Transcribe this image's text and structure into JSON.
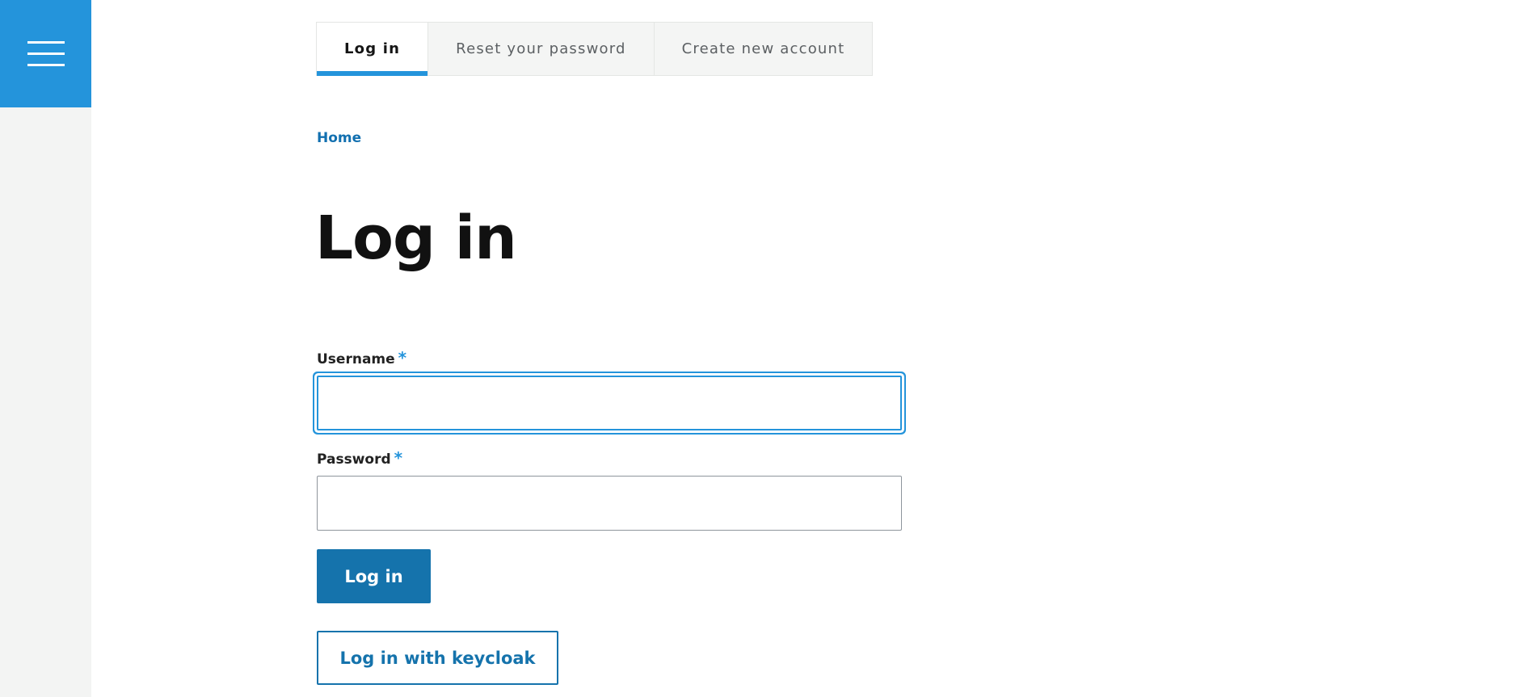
{
  "sidebar": {
    "menu_icon": "hamburger-menu-icon"
  },
  "tabs": [
    {
      "label": "Log in",
      "active": true
    },
    {
      "label": "Reset your password",
      "active": false
    },
    {
      "label": "Create new account",
      "active": false
    }
  ],
  "breadcrumb": {
    "home": "Home"
  },
  "page": {
    "title": "Log in"
  },
  "form": {
    "username_label": "Username",
    "username_value": "",
    "password_label": "Password",
    "password_value": "",
    "required_marker": "*",
    "submit_label": "Log in",
    "keycloak_label": "Log in with keycloak"
  },
  "colors": {
    "accent": "#2494db",
    "primary_button": "#1573ac",
    "link": "#1270b0",
    "sidebar_bg": "#f3f4f3"
  }
}
